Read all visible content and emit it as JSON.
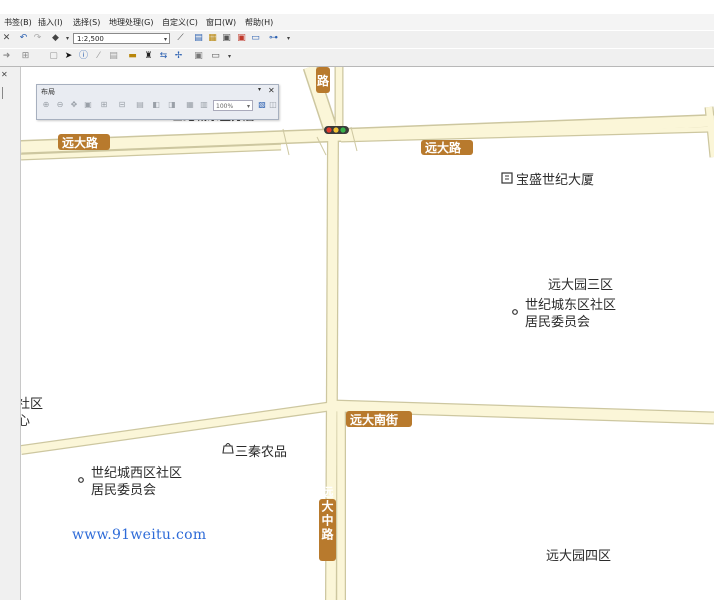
{
  "menu": [
    "书签(B)",
    "插入(I)",
    "选择(S)",
    "地理处理(G)",
    "自定义(C)",
    "窗口(W)",
    "帮助(H)"
  ],
  "toolbar": {
    "scale_value": "1:2,500",
    "icons_row1": [
      "close-icon",
      "undo-icon",
      "redo-icon",
      "add-data-icon",
      "dropdown-arrow-icon"
    ],
    "icons_row1_right": [
      "editor-icon",
      "table-icon",
      "catalog-icon",
      "toolbox-icon",
      "python-icon",
      "window-icon",
      "model-icon",
      "more-icon"
    ],
    "icons_row2": [
      "forward-icon",
      "full-extent-icon",
      "select-icon",
      "identify-icon",
      "measure-icon",
      "find-icon",
      "route-icon",
      "hyperlink-icon",
      "html-popup-icon",
      "time-slider-icon",
      "more-icon"
    ]
  },
  "layout_panel": {
    "title": "布局",
    "zoom_value": "100%"
  },
  "map": {
    "roads": {
      "north_road": "远大路",
      "south_street": "远大南街",
      "center_road": "远大中路",
      "top_fragment": "路"
    },
    "places": {
      "building": "宝盛世纪大厦",
      "community_label": "远大园三区",
      "east_committee_line1": "世纪城东区社区",
      "east_committee_line2": "居民委员会",
      "west_committee_line1": "世纪城西区社区",
      "west_committee_line2": "居民委员会",
      "shop": "三秦农品",
      "zone4": "远大园四区",
      "left_fragment_1": "社区",
      "left_fragment_2": "心",
      "occluded_label": "世纪城东区分店"
    },
    "colors": {
      "road_fill": "#fbf6d8",
      "road_edge": "#cdc7a0",
      "shield": "#b87a2d",
      "label": "#2b2b2b"
    }
  },
  "watermark": "www.91weitu.com"
}
